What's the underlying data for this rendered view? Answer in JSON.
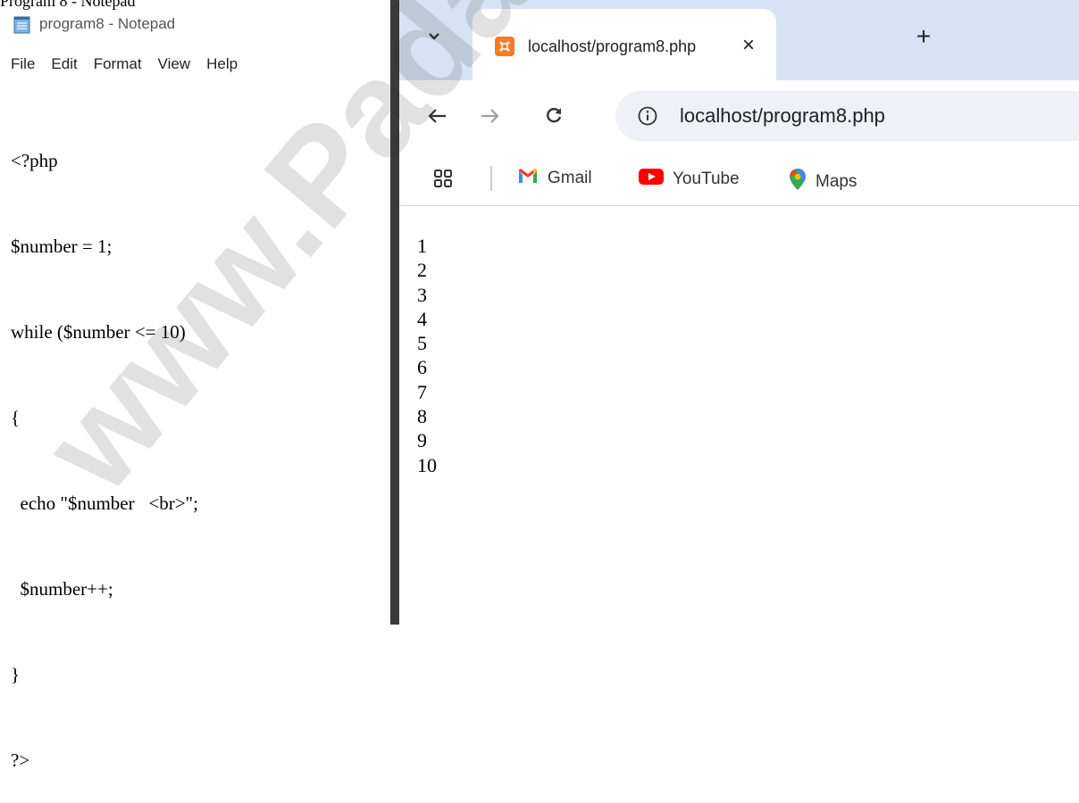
{
  "caption": {
    "text": "Program 8 - Notepad"
  },
  "notepad": {
    "title": "program8 - Notepad",
    "menu": [
      "File",
      "Edit",
      "Format",
      "View",
      "Help"
    ],
    "code_lines": [
      "<?php",
      "$number = 1;",
      "while ($number <= 10)",
      "{",
      "  echo \"$number   <br>\";",
      "  $number++;",
      "}",
      "?>"
    ]
  },
  "browser": {
    "tab_title": "localhost/program8.php",
    "tab_close": "×",
    "new_tab": "+",
    "url": "localhost/program8.php",
    "bookmarks": [
      "Gmail",
      "YouTube",
      "Maps"
    ],
    "output_lines": [
      "1",
      "2",
      "3",
      "4",
      "5",
      "6",
      "7",
      "8",
      "9",
      "10"
    ]
  },
  "watermark": {
    "text": "www.Padasalai.Net"
  },
  "icons": [
    "notepad-icon",
    "tab-dropdown-icon",
    "xampp-favicon-icon",
    "close-icon",
    "plus-icon",
    "back-arrow-icon",
    "forward-arrow-icon",
    "reload-icon",
    "site-info-icon",
    "apps-grid-icon",
    "gmail-icon",
    "youtube-icon",
    "maps-pin-icon"
  ],
  "colors": {
    "tabbar_bg": "#d7e3f5",
    "omnibox_bg": "#eef1f6",
    "xampp_orange": "#fb7a24",
    "youtube_red": "#ff0000"
  }
}
